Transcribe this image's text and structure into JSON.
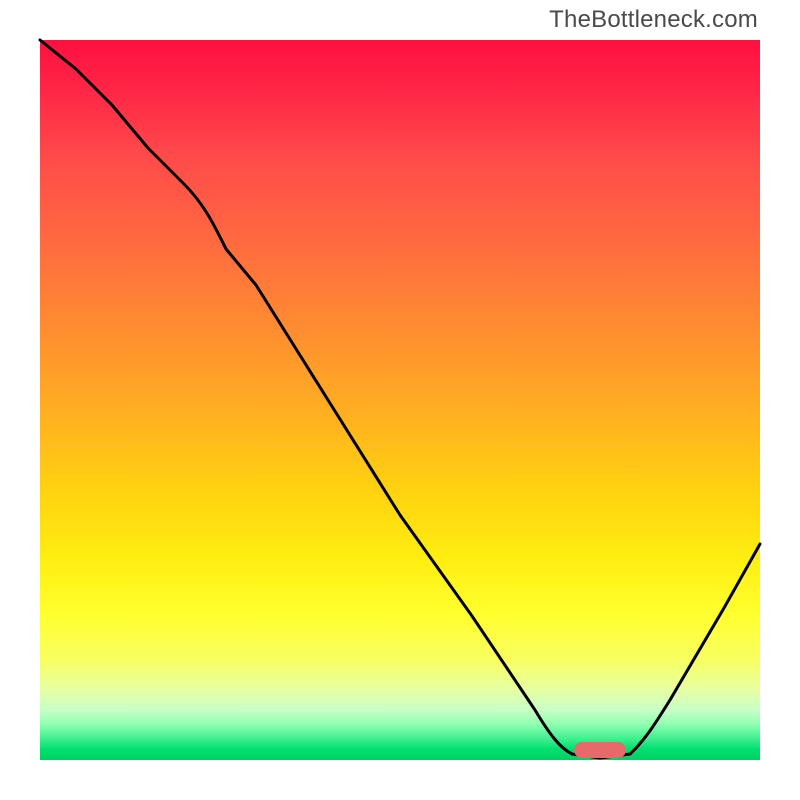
{
  "watermark": "TheBottleneck.com",
  "chart_data": {
    "type": "line",
    "title": "",
    "xlabel": "",
    "ylabel": "",
    "xlim": [
      0,
      100
    ],
    "ylim": [
      0,
      100
    ],
    "grid": false,
    "legend": false,
    "x": [
      0,
      5,
      10,
      15,
      20,
      25,
      30,
      35,
      40,
      45,
      50,
      55,
      60,
      65,
      70,
      73,
      76,
      80,
      85,
      90,
      95,
      100
    ],
    "values": [
      100,
      96,
      91,
      85,
      80,
      74,
      66,
      58,
      50,
      42,
      34,
      27,
      20,
      13,
      6,
      2,
      0,
      0,
      6,
      14,
      22,
      30
    ],
    "annotations": [
      {
        "type": "marker",
        "shape": "rounded-rect",
        "x": 77,
        "y": 2,
        "color": "#e66a6a"
      }
    ]
  },
  "colors": {
    "gradient_top": "#ff1040",
    "gradient_mid": "#ffd000",
    "gradient_bottom": "#00d060",
    "curve": "#000000",
    "marker": "#e66a6a"
  }
}
